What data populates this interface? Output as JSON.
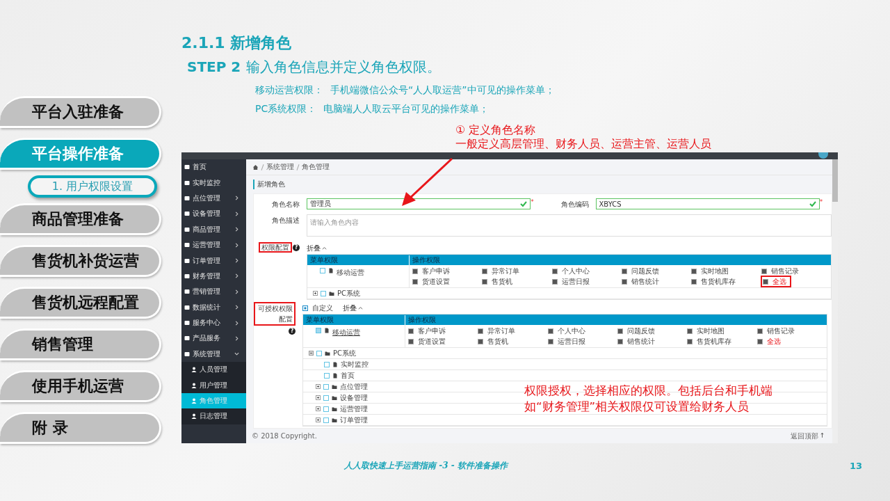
{
  "nav": {
    "items": [
      {
        "label": "平台入驻准备",
        "selected": false
      },
      {
        "label": "平台操作准备",
        "selected": true,
        "children": [
          {
            "label": "1. 用户权限设置",
            "selected": true
          }
        ]
      },
      {
        "label": "商品管理准备",
        "selected": false
      },
      {
        "label": "售货机补货运营",
        "selected": false
      },
      {
        "label": "售货机远程配置",
        "selected": false
      },
      {
        "label": "销售管理",
        "selected": false
      },
      {
        "label": "使用手机运营",
        "selected": false
      },
      {
        "label": "附 录",
        "selected": false
      }
    ]
  },
  "heading": "2.1.1 新增角色",
  "step": {
    "label": "STEP 2",
    "text": "输入角色信息并定义角色权限。"
  },
  "notes": [
    {
      "label": "移动运营权限：",
      "text": "手机端微信公众号“人人取运营”中可见的操作菜单；"
    },
    {
      "label": "PC系统权限：",
      "text": "电脑端人人取云平台可见的操作菜单；"
    }
  ],
  "callout": {
    "title": "① 定义角色名称",
    "text": "一般定义高层管理、财务人员、运营主管、运营人员"
  },
  "app": {
    "sidebar": {
      "items": [
        {
          "label": "首页",
          "kind": "link"
        },
        {
          "label": "实时监控",
          "kind": "link"
        },
        {
          "label": "点位管理",
          "kind": "menu",
          "expanded": false
        },
        {
          "label": "设备管理",
          "kind": "menu",
          "expanded": false
        },
        {
          "label": "商品管理",
          "kind": "menu",
          "expanded": false
        },
        {
          "label": "运营管理",
          "kind": "menu",
          "expanded": false
        },
        {
          "label": "订单管理",
          "kind": "menu",
          "expanded": false
        },
        {
          "label": "财务管理",
          "kind": "menu",
          "expanded": false
        },
        {
          "label": "营销管理",
          "kind": "menu",
          "expanded": false
        },
        {
          "label": "数据统计",
          "kind": "menu",
          "expanded": false
        },
        {
          "label": "服务中心",
          "kind": "menu",
          "expanded": false
        },
        {
          "label": "产品服务",
          "kind": "menu",
          "expanded": false
        },
        {
          "label": "系统管理",
          "kind": "menu",
          "expanded": true,
          "children": [
            {
              "label": "人员管理",
              "selected": false
            },
            {
              "label": "用户管理",
              "selected": false
            },
            {
              "label": "角色管理",
              "selected": true
            },
            {
              "label": "日志管理",
              "selected": false
            }
          ]
        }
      ]
    },
    "breadcrumb": [
      "系统管理",
      "角色管理"
    ],
    "page_title": "新增角色",
    "form": {
      "fields": [
        {
          "label": "角色名称",
          "value": "管理员",
          "valid": true,
          "required_mark": "*"
        },
        {
          "label": "角色编码",
          "value": "XBYCS",
          "valid": true,
          "required_mark": "*"
        }
      ],
      "description": {
        "label": "角色描述",
        "placeholder": "请输入角色内容"
      }
    },
    "permissions": {
      "label": "权限配置",
      "help": "?",
      "toggle": "折叠",
      "columns": [
        "菜单权限",
        "操作权限"
      ],
      "mobile": {
        "label": "移动运营",
        "checked": false,
        "operations": [
          {
            "label": "客户申诉",
            "checked": true
          },
          {
            "label": "异常订单",
            "checked": true
          },
          {
            "label": "个人中心",
            "checked": true
          },
          {
            "label": "问题反馈",
            "checked": true
          },
          {
            "label": "实时地图",
            "checked": true
          },
          {
            "label": "销售记录",
            "checked": true
          },
          {
            "label": "货道设置",
            "checked": true
          },
          {
            "label": "售货机",
            "checked": true
          },
          {
            "label": "运营日报",
            "checked": true
          },
          {
            "label": "销售统计",
            "checked": true
          },
          {
            "label": "售货机库存",
            "checked": true
          }
        ],
        "select_all": {
          "label": "全选",
          "checked": true
        }
      },
      "pc": {
        "label": "PC系统",
        "checked": false,
        "expanded": false
      }
    },
    "grantable": {
      "label": "可授权权限配置",
      "help": "?",
      "custom": {
        "label": "自定义",
        "checked": true
      },
      "toggle": "折叠",
      "columns": [
        "菜单权限",
        "操作权限"
      ],
      "mobile": {
        "label": "移动运营",
        "checked": true,
        "operations": [
          {
            "label": "客户申诉",
            "checked": true
          },
          {
            "label": "异常订单",
            "checked": true
          },
          {
            "label": "个人中心",
            "checked": true
          },
          {
            "label": "问题反馈",
            "checked": true
          },
          {
            "label": "实时地图",
            "checked": true
          },
          {
            "label": "销售记录",
            "checked": true
          },
          {
            "label": "货道设置",
            "checked": true
          },
          {
            "label": "售货机",
            "checked": true
          },
          {
            "label": "运营日报",
            "checked": true
          },
          {
            "label": "销售统计",
            "checked": true
          },
          {
            "label": "售货机库存",
            "checked": true
          }
        ],
        "select_all": {
          "label": "全选",
          "checked": true
        }
      },
      "pc": {
        "label": "PC系统",
        "checked": false,
        "expanded": true,
        "children": [
          {
            "label": "实时监控",
            "kind": "page",
            "checked": false
          },
          {
            "label": "首页",
            "kind": "page",
            "checked": false
          },
          {
            "label": "点位管理",
            "kind": "folder",
            "checked": false,
            "expanded": false
          },
          {
            "label": "设备管理",
            "kind": "folder",
            "checked": false,
            "expanded": false
          },
          {
            "label": "运营管理",
            "kind": "folder",
            "checked": false,
            "expanded": false
          },
          {
            "label": "订单管理",
            "kind": "folder",
            "checked": false,
            "expanded": false
          }
        ]
      }
    },
    "copyright": "© 2018 Copyright.",
    "back_to_top": "返回顶部"
  },
  "note": {
    "lines": [
      "权限授权，选择相应的权限。包括后台和手机端",
      "如“财务管理”相关权限仅可设置给财务人员"
    ]
  },
  "footer": {
    "title": "人人取快速上手运营指南 -3 - 软件准备操作",
    "page": "13"
  }
}
